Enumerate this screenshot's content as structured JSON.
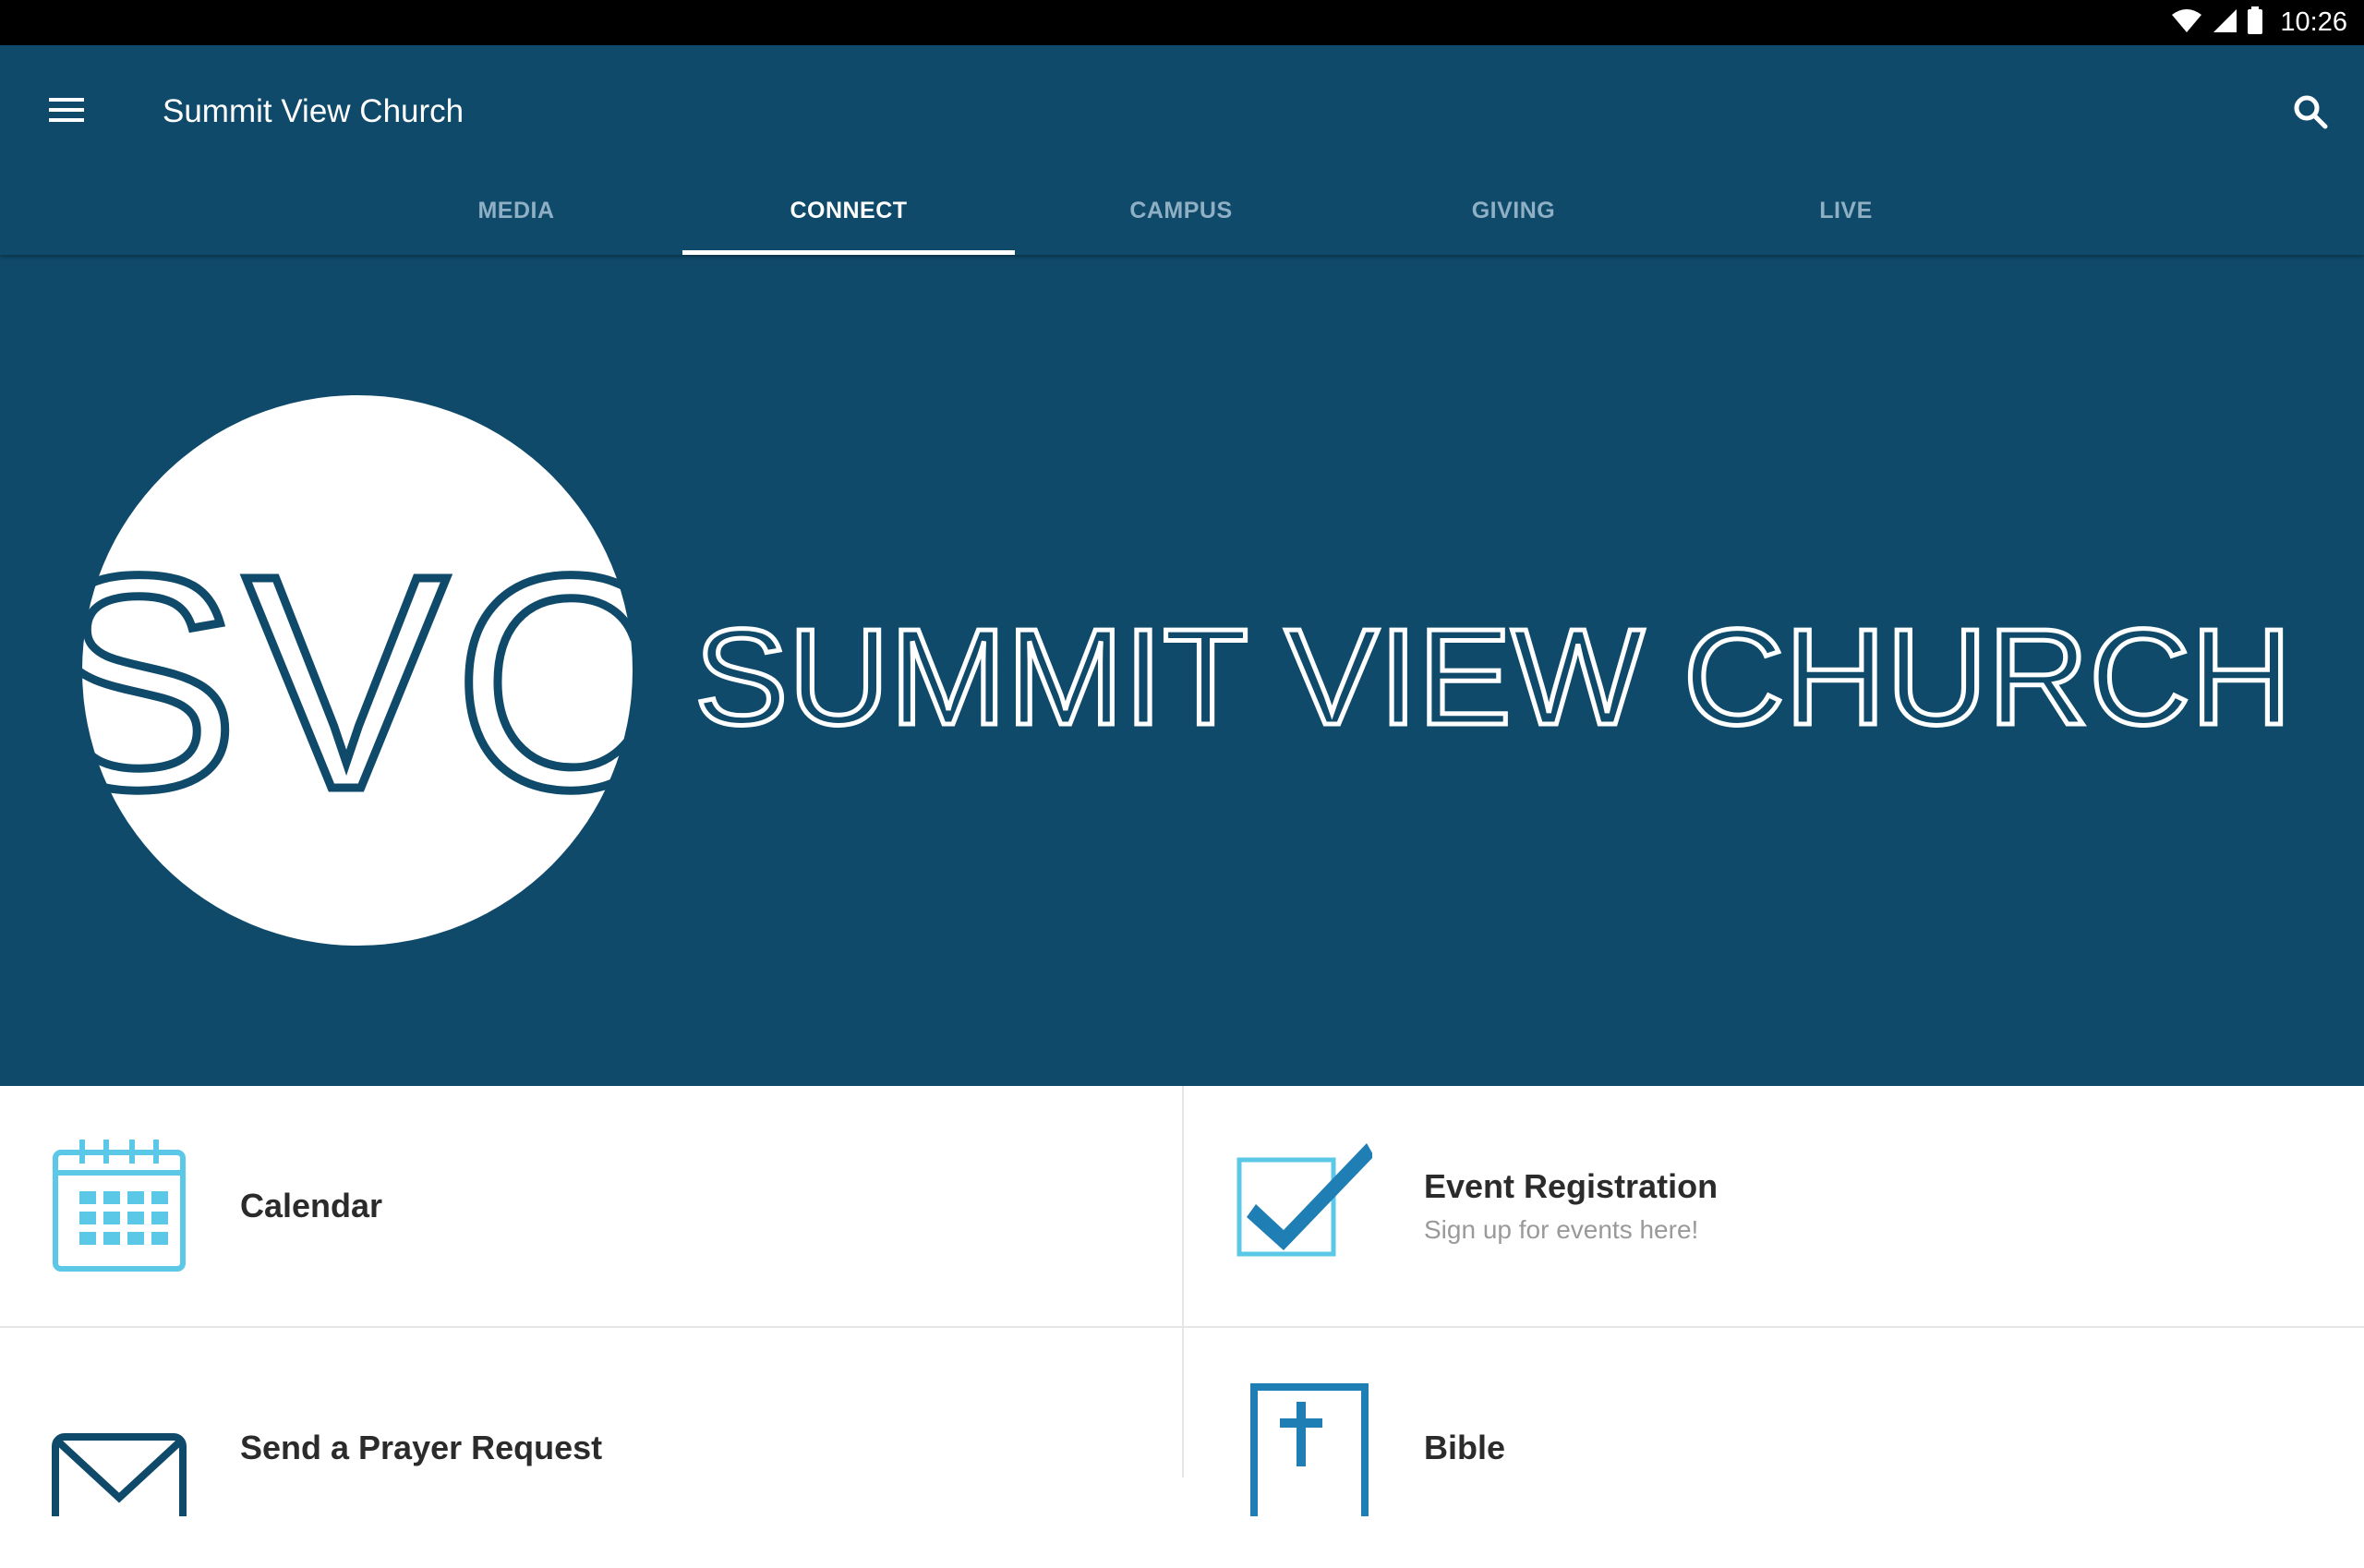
{
  "status_bar": {
    "time": "10:26",
    "icons": [
      "wifi-icon",
      "cell-signal-icon",
      "battery-icon"
    ]
  },
  "app_bar": {
    "title": "Summit View Church",
    "menu_icon": "hamburger-menu-icon",
    "search_icon": "search-icon",
    "background_color": "#0f4a6a"
  },
  "tabs": [
    {
      "label": "MEDIA",
      "active": false
    },
    {
      "label": "CONNECT",
      "active": true
    },
    {
      "label": "CAMPUS",
      "active": false
    },
    {
      "label": "GIVING",
      "active": false
    },
    {
      "label": "LIVE",
      "active": false
    }
  ],
  "hero": {
    "logo_monogram": "SVC",
    "logo_text": "SUMMIT VIEW CHURCH"
  },
  "tiles": [
    {
      "title": "Calendar",
      "subtitle": "",
      "icon": "calendar-icon",
      "icon_color": "#5bc8e8"
    },
    {
      "title": "Event Registration",
      "subtitle": "Sign up for events here!",
      "icon": "checkbox-checked-icon",
      "icon_color": "#1f7fb5"
    },
    {
      "title": "Send a Prayer Request",
      "subtitle": "",
      "icon": "envelope-icon",
      "icon_color": "#0f4a6a"
    },
    {
      "title": "Bible",
      "subtitle": "",
      "icon": "bible-icon",
      "icon_color": "#1f7fb5"
    }
  ]
}
